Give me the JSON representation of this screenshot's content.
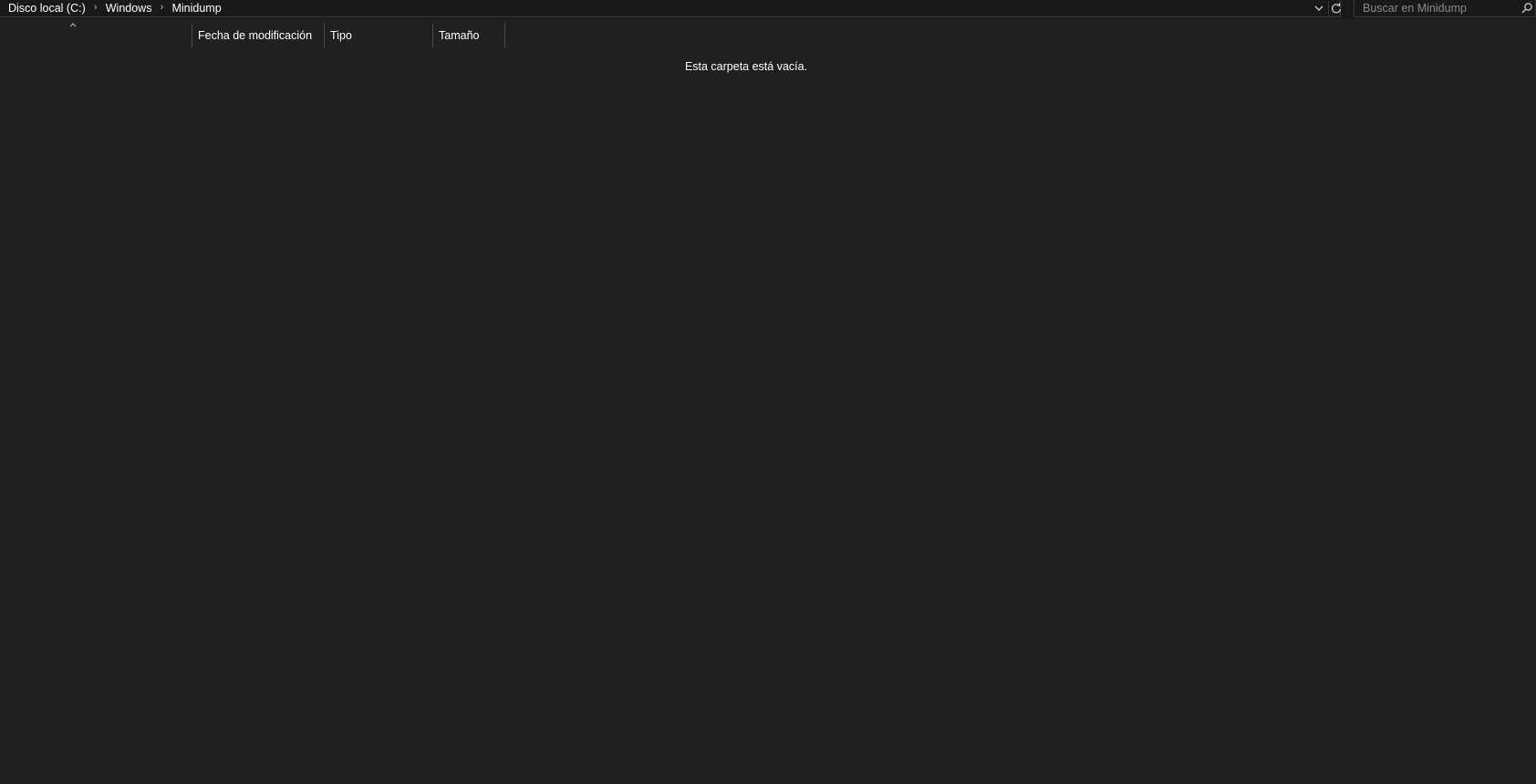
{
  "address_bar": {
    "breadcrumb": [
      "Disco local (C:)",
      "Windows",
      "Minidump"
    ],
    "separator_icon": "chevron-right-icon",
    "dropdown_icon": "chevron-down-icon",
    "refresh_icon": "refresh-icon"
  },
  "search": {
    "placeholder": "Buscar en Minidump",
    "value": "",
    "icon": "search-icon"
  },
  "columns": {
    "sort_icon": "chevron-up-icon",
    "headers": [
      "Fecha de modificación",
      "Tipo",
      "Tamaño"
    ]
  },
  "content": {
    "empty_message": "Esta carpeta está vacía."
  },
  "colors": {
    "background": "#202020",
    "address_bar_bg": "#191919",
    "border": "#3a3a3a",
    "text": "#ffffff",
    "placeholder": "#8a8a8a"
  }
}
